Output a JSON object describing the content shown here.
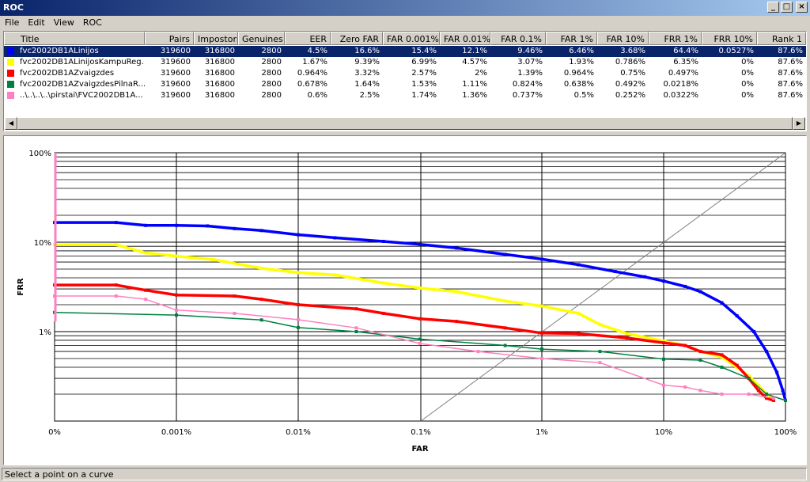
{
  "window": {
    "title": "ROC"
  },
  "menu": [
    "File",
    "Edit",
    "View",
    "ROC"
  ],
  "table": {
    "columns": [
      "Title",
      "Pairs",
      "Impostors",
      "Genuines",
      "EER",
      "Zero FAR",
      "FAR 0.001%",
      "FAR 0.01%",
      "FAR 0.1%",
      "FAR 1%",
      "FAR 10%",
      "FRR 1%",
      "FRR 10%",
      "Rank 1"
    ],
    "rows": [
      {
        "color": "#0000ff",
        "selected": true,
        "cells": [
          "fvc2002DB1ALinijos",
          "319600",
          "316800",
          "2800",
          "4.5%",
          "16.6%",
          "15.4%",
          "12.1%",
          "9.46%",
          "6.46%",
          "3.68%",
          "64.4%",
          "0.0527%",
          "87.6%"
        ]
      },
      {
        "color": "#ffff00",
        "selected": false,
        "cells": [
          "fvc2002DB1ALinijosKampuReg...",
          "319600",
          "316800",
          "2800",
          "1.67%",
          "9.39%",
          "6.99%",
          "4.57%",
          "3.07%",
          "1.93%",
          "0.786%",
          "6.35%",
          "0%",
          "87.6%"
        ]
      },
      {
        "color": "#ff0000",
        "selected": false,
        "cells": [
          "fvc2002DB1AZvaigzdes",
          "319600",
          "316800",
          "2800",
          "0.964%",
          "3.32%",
          "2.57%",
          "2%",
          "1.39%",
          "0.964%",
          "0.75%",
          "0.497%",
          "0%",
          "87.6%"
        ]
      },
      {
        "color": "#008040",
        "selected": false,
        "cells": [
          "fvc2002DB1AZvaigzdesPilnaR...",
          "319600",
          "316800",
          "2800",
          "0.678%",
          "1.64%",
          "1.53%",
          "1.11%",
          "0.824%",
          "0.638%",
          "0.492%",
          "0.0218%",
          "0%",
          "87.6%"
        ]
      },
      {
        "color": "#ff80c0",
        "selected": false,
        "cells": [
          "..\\..\\..\\..\\pirstai\\FVC2002DB1A...",
          "319600",
          "316800",
          "2800",
          "0.6%",
          "2.5%",
          "1.74%",
          "1.36%",
          "0.737%",
          "0.5%",
          "0.252%",
          "0.0322%",
          "0%",
          "87.6%"
        ]
      }
    ]
  },
  "chart_data": {
    "type": "line",
    "xlabel": "FAR",
    "ylabel": "FRR",
    "x_ticks": [
      "0%",
      "0.001%",
      "0.01%",
      "0.1%",
      "1%",
      "10%",
      "100%"
    ],
    "y_ticks": [
      "100%",
      "10%",
      "1%"
    ],
    "y_scale": "log",
    "x_scale": "log",
    "grid": true,
    "series": [
      {
        "name": "fvc2002DB1ALinijos",
        "color": "#0000ff",
        "points": [
          [
            0,
            16.6
          ],
          [
            0.00032,
            16.6
          ],
          [
            0.00056,
            15.4
          ],
          [
            0.001,
            15.4
          ],
          [
            0.0018,
            15.2
          ],
          [
            0.003,
            14.2
          ],
          [
            0.005,
            13.5
          ],
          [
            0.01,
            12.1
          ],
          [
            0.02,
            11.2
          ],
          [
            0.05,
            10.2
          ],
          [
            0.1,
            9.46
          ],
          [
            0.2,
            8.6
          ],
          [
            0.5,
            7.3
          ],
          [
            1,
            6.46
          ],
          [
            2,
            5.6
          ],
          [
            4,
            4.7
          ],
          [
            7,
            4.1
          ],
          [
            10,
            3.68
          ],
          [
            15,
            3.2
          ],
          [
            20,
            2.8
          ],
          [
            30,
            2.1
          ],
          [
            40,
            1.5
          ],
          [
            55,
            1.0
          ],
          [
            70,
            0.6
          ],
          [
            85,
            0.35
          ],
          [
            95,
            0.22
          ],
          [
            100,
            0.17
          ]
        ]
      },
      {
        "name": "fvc2002DB1ALinijosKampuReg...",
        "color": "#ffff00",
        "points": [
          [
            0,
            9.39
          ],
          [
            0.00032,
            9.39
          ],
          [
            0.00056,
            7.6
          ],
          [
            0.001,
            6.99
          ],
          [
            0.002,
            6.4
          ],
          [
            0.005,
            5.1
          ],
          [
            0.01,
            4.57
          ],
          [
            0.02,
            4.3
          ],
          [
            0.05,
            3.5
          ],
          [
            0.1,
            3.07
          ],
          [
            0.2,
            2.8
          ],
          [
            0.5,
            2.2
          ],
          [
            1,
            1.93
          ],
          [
            2,
            1.6
          ],
          [
            3,
            1.2
          ],
          [
            5,
            0.95
          ],
          [
            10,
            0.786
          ],
          [
            15,
            0.7
          ],
          [
            20,
            0.6
          ],
          [
            30,
            0.52
          ],
          [
            40,
            0.4
          ],
          [
            50,
            0.32
          ],
          [
            60,
            0.25
          ],
          [
            70,
            0.2
          ],
          [
            80,
            0.18
          ]
        ]
      },
      {
        "name": "fvc2002DB1AZvaigzdes",
        "color": "#ff0000",
        "points": [
          [
            0,
            3.32
          ],
          [
            0.00032,
            3.32
          ],
          [
            0.00056,
            2.9
          ],
          [
            0.001,
            2.57
          ],
          [
            0.003,
            2.5
          ],
          [
            0.005,
            2.3
          ],
          [
            0.01,
            2.0
          ],
          [
            0.03,
            1.8
          ],
          [
            0.05,
            1.6
          ],
          [
            0.1,
            1.39
          ],
          [
            0.2,
            1.3
          ],
          [
            0.5,
            1.1
          ],
          [
            1,
            0.964
          ],
          [
            2,
            0.95
          ],
          [
            5,
            0.85
          ],
          [
            10,
            0.75
          ],
          [
            15,
            0.7
          ],
          [
            20,
            0.6
          ],
          [
            30,
            0.55
          ],
          [
            40,
            0.42
          ],
          [
            50,
            0.3
          ],
          [
            60,
            0.22
          ],
          [
            70,
            0.18
          ],
          [
            80,
            0.17
          ]
        ]
      },
      {
        "name": "fvc2002DB1AZvaigzdesPilnaR...",
        "color": "#008040",
        "points": [
          [
            0,
            1.64
          ],
          [
            0.001,
            1.53
          ],
          [
            0.005,
            1.35
          ],
          [
            0.01,
            1.11
          ],
          [
            0.03,
            1.0
          ],
          [
            0.1,
            0.824
          ],
          [
            0.5,
            0.7
          ],
          [
            1,
            0.638
          ],
          [
            3,
            0.6
          ],
          [
            10,
            0.492
          ],
          [
            20,
            0.48
          ],
          [
            30,
            0.4
          ],
          [
            50,
            0.3
          ],
          [
            70,
            0.2
          ],
          [
            100,
            0.17
          ]
        ]
      },
      {
        "name": "..\\..\\..\\..\\pirstai\\FVC2002DB1A...",
        "color": "#ff80c0",
        "points": [
          [
            0,
            2.5
          ],
          [
            0.00032,
            2.5
          ],
          [
            0.00056,
            2.3
          ],
          [
            0.001,
            1.74
          ],
          [
            0.003,
            1.6
          ],
          [
            0.01,
            1.36
          ],
          [
            0.03,
            1.1
          ],
          [
            0.1,
            0.737
          ],
          [
            0.3,
            0.6
          ],
          [
            1,
            0.5
          ],
          [
            3,
            0.45
          ],
          [
            10,
            0.252
          ],
          [
            15,
            0.24
          ],
          [
            20,
            0.22
          ],
          [
            30,
            0.2
          ],
          [
            50,
            0.2
          ],
          [
            80,
            0.18
          ]
        ]
      }
    ]
  },
  "status": {
    "text": "Select a point on a curve"
  }
}
